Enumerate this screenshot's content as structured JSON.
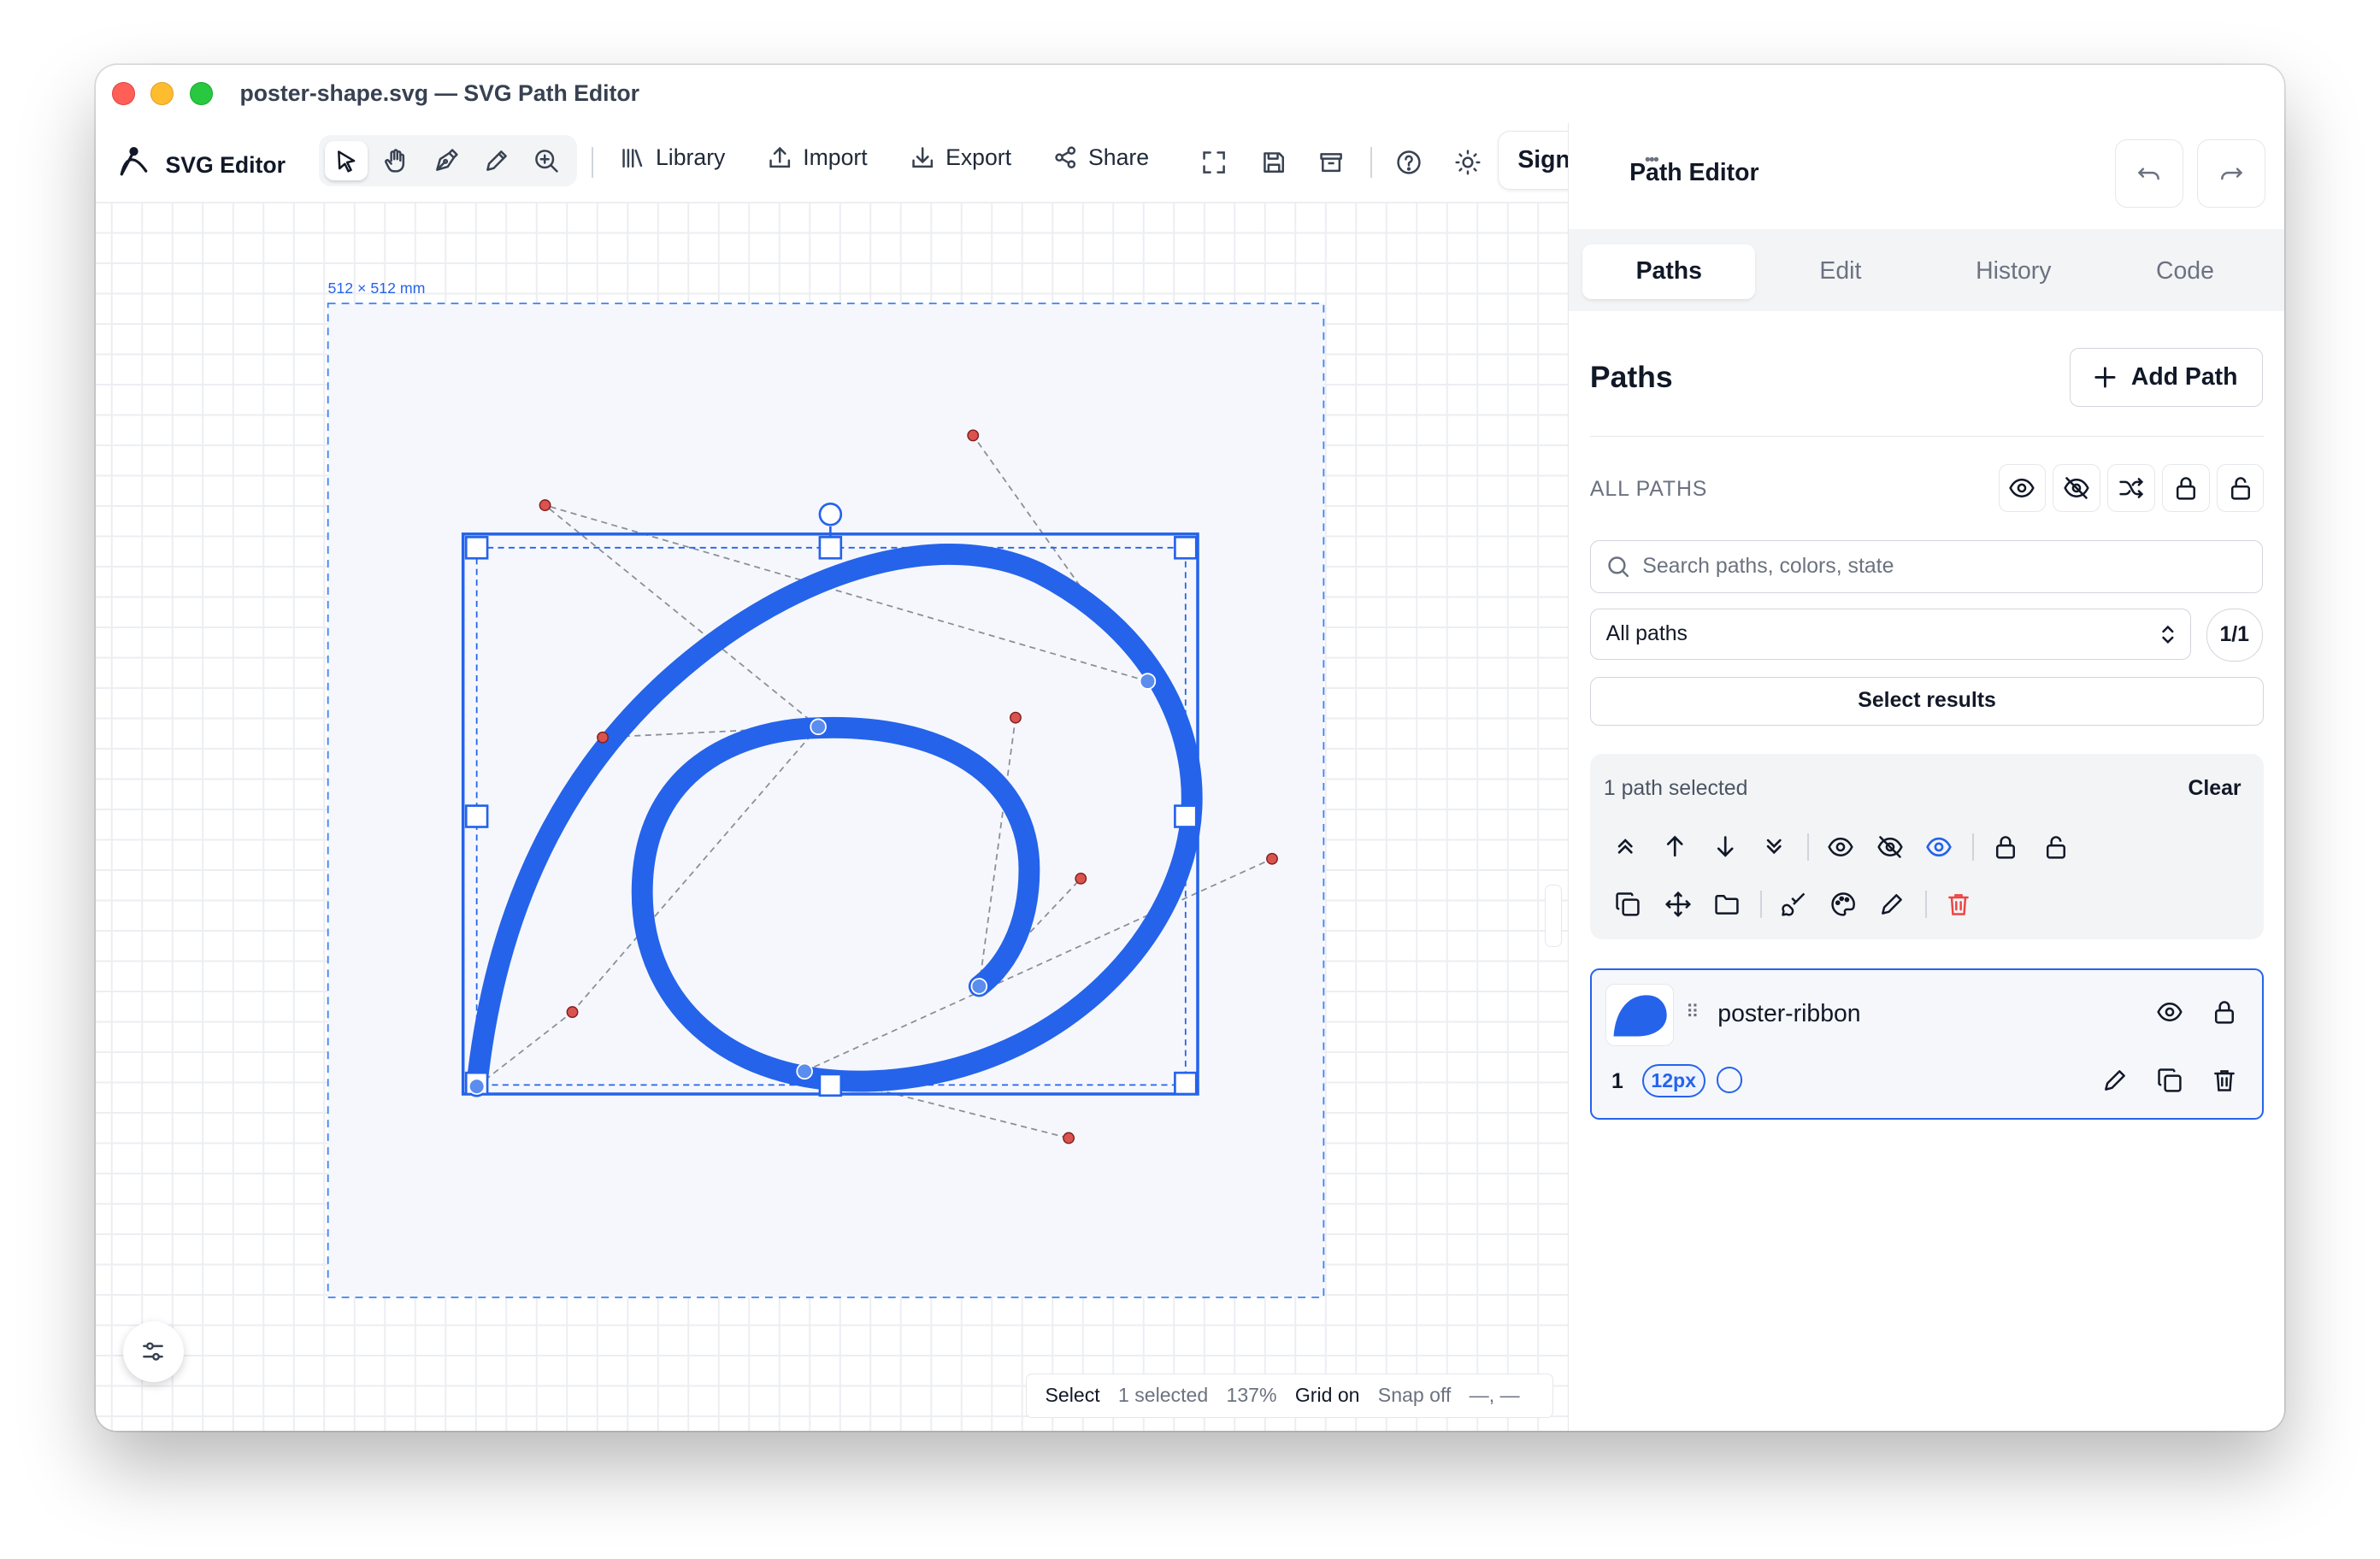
{
  "window": {
    "title": "poster-shape.svg — SVG Path Editor"
  },
  "toolbar": {
    "brand": "SVG Editor",
    "tools": [
      "select-tool",
      "hand-tool",
      "pen-tool",
      "pencil-tool",
      "zoom-tool"
    ],
    "library": "Library",
    "import": "Import",
    "export": "Export",
    "share": "Share",
    "sign_in": "Sign In"
  },
  "canvas": {
    "artboard_label": "512 × 512 mm",
    "accent": "#2563eb",
    "handle_color": "#d9534f"
  },
  "statusbar": {
    "mode": "Select",
    "selected": "1 selected",
    "zoom": "137%",
    "grid": "Grid on",
    "snap": "Snap off",
    "coords": "—, —"
  },
  "panel": {
    "title": "Path Editor",
    "tabs": [
      "Paths",
      "Edit",
      "History",
      "Code"
    ],
    "active_tab": "Paths",
    "section_title": "Paths",
    "add_path": "Add Path",
    "all_paths_label": "ALL PATHS",
    "search_placeholder": "Search paths, colors, state",
    "filter_value": "All paths",
    "count": "1/1",
    "select_results": "Select results",
    "selection": {
      "label": "1 path selected",
      "clear": "Clear"
    },
    "path_item": {
      "name": "poster-ribbon",
      "index": "1",
      "stroke_width": "12px",
      "fill_color": "#2563eb"
    }
  }
}
